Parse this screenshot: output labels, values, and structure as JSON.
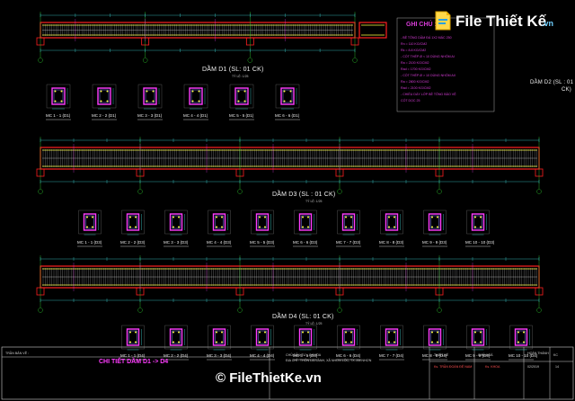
{
  "drawing": {
    "beam1": {
      "title": "DẦM D1 (SL: 01 CK)",
      "scale": "TỶ LỆ: 1/25",
      "sections": [
        "MC 1 - 1 (D1)",
        "MC 2 - 2 (D1)",
        "MC 3 - 3 (D1)",
        "MC 4 - 4 (D1)",
        "MC 5 - 5 (D1)",
        "MC 6 - 6 (D1)"
      ]
    },
    "beam2": {
      "title_line1": "DẦM D2 (SL : 01",
      "title_line2": "CK)"
    },
    "beam3": {
      "title": "DẦM D3 (SL : 01 CK)",
      "scale": "TỶ LỆ: 1/25",
      "sections": [
        "MC 1 - 1 (D3)",
        "MC 2 - 2 (D3)",
        "MC 3 - 3 (D3)",
        "MC 4 - 4 (D3)",
        "MC 5 - 5 (D3)",
        "MC 6 - 6 (D3)",
        "MC 7 - 7 (D3)",
        "MC 8 - 8 (D3)",
        "MC 9 - 9 (D3)",
        "MC 10 - 10 (D3)"
      ]
    },
    "beam4": {
      "title": "DẦM D4 (SL: 01 CK)",
      "scale": "TỶ LỆ: 1/25",
      "sections": [
        "MC 1 - 1 (D4)",
        "MC 2 - 2 (D4)",
        "MC 3 - 3 (D4)",
        "MC 4 - 4 (D4)",
        "MC 5 - 5 (D4)",
        "MC 6 - 6 (D4)",
        "MC 7 - 7 (D4)",
        "MC 8 - 8 (D4)",
        "MC 9 - 9 (D4)",
        "MC 10 - 10 (D4)"
      ]
    }
  },
  "notes": {
    "heading": "GHI CHÚ :",
    "lines": [
      "- BÊ TÔNG DẦM ĐÁ 1X2 MÁC 250",
      "  Rn = 110 KG/CM2",
      "  Rk = 8.8 KG/CM2",
      "- CỐT THÉP Ø < 10 DÙNG NHÓM AI",
      "  Ra = 2100 KG/CM2",
      "  Rad = 1700 KG/CM2",
      "- CỐT THÉP Ø > 10 DÙNG NHÓM AII",
      "  Ra = 2800 KG/CM2",
      "  Rad = 2100 KG/CM2",
      "- CHIỀU DÀY LỚP BÊ TÔNG BẢO VỆ",
      "  CỐT DỌC 25"
    ]
  },
  "title_block": {
    "left_label": "TRẦN BẢN VẼ :",
    "drawing_name": "CHI TIẾT DẦM D1 -> D4",
    "project_line1": "CHỦ ĐẦU TƯ : X KHOA",
    "project_line2": "ĐỊA CHỈ : THÔN LAI LÀNH, XÃ NHƠN LỘC, TX. AN NHƠN",
    "col_design": "THIẾT KẾ",
    "col_check": "CHỦ NHIỆM",
    "col_approve": "CHỦ HOÀ",
    "col_code": "HOÀN THÀNH",
    "col_sheet": "KC",
    "designer": "Ks. TRẦN ĐOÀN ĐỆ NAM",
    "approver": "Ks. KHOA",
    "date": "02/2019",
    "sheet_no": "14"
  },
  "branding": {
    "logo_text": "File Thiết Kế",
    "logo_suffix": ".vn",
    "watermark": "© FileThietKe.vn"
  },
  "colors": {
    "background": "#000000",
    "concrete": "#ff2020",
    "rebar": "#ffff40",
    "dimension": "#3cd3d3",
    "stirrup": "#8080ff",
    "accent": "#ff3cff",
    "green": "#30d030"
  }
}
